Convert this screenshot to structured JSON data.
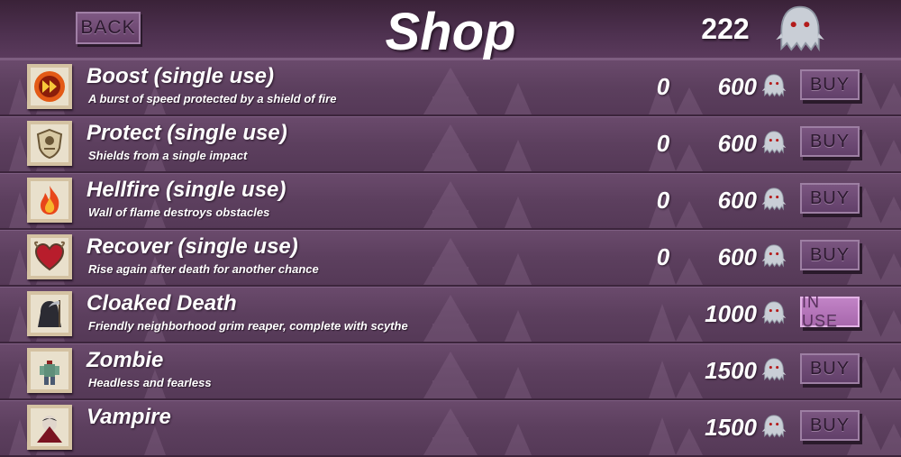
{
  "header": {
    "back_label": "BACK",
    "title": "Shop",
    "coins": "222"
  },
  "items": [
    {
      "name": "Boost (single use)",
      "desc": "A burst of speed protected by a shield of fire",
      "owned": "0",
      "price": "600",
      "action": "BUY",
      "icon": "boost-icon"
    },
    {
      "name": "Protect (single use)",
      "desc": "Shields from a single impact",
      "owned": "0",
      "price": "600",
      "action": "BUY",
      "icon": "shield-icon"
    },
    {
      "name": "Hellfire (single use)",
      "desc": "Wall of flame destroys obstacles",
      "owned": "0",
      "price": "600",
      "action": "BUY",
      "icon": "fire-icon"
    },
    {
      "name": "Recover (single use)",
      "desc": "Rise again after death for another chance",
      "owned": "0",
      "price": "600",
      "action": "BUY",
      "icon": "heart-icon"
    },
    {
      "name": "Cloaked Death",
      "desc": "Friendly neighborhood grim reaper, complete with scythe",
      "owned": "",
      "price": "1000",
      "action": "IN USE",
      "icon": "reaper-icon"
    },
    {
      "name": "Zombie",
      "desc": "Headless and fearless",
      "owned": "",
      "price": "1500",
      "action": "BUY",
      "icon": "zombie-icon"
    },
    {
      "name": "Vampire",
      "desc": "",
      "owned": "",
      "price": "1500",
      "action": "BUY",
      "icon": "vampire-icon"
    }
  ],
  "colors": {
    "background": "#4a2f4a",
    "row": "#5c3f5e",
    "button": "#6e4a74",
    "in_use_button": "#b574ba",
    "text": "#ffffff"
  }
}
